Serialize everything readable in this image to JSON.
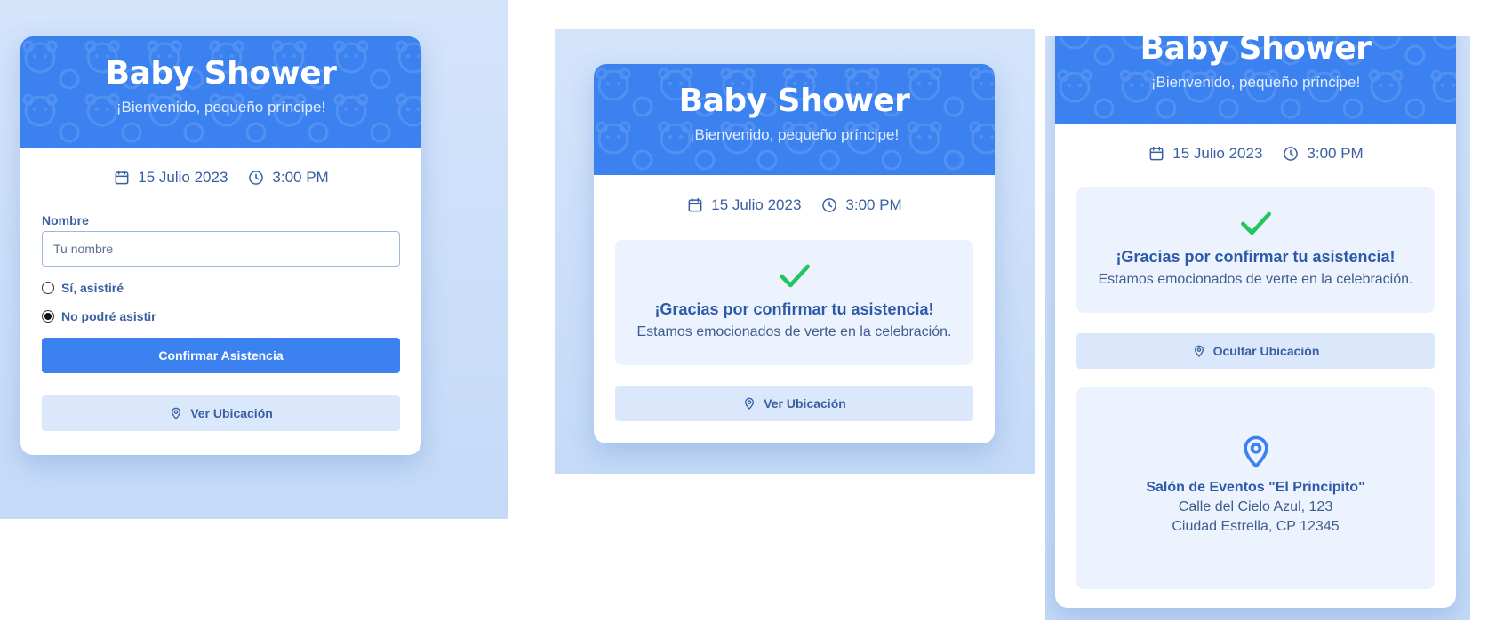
{
  "event": {
    "title": "Baby Shower",
    "subtitle": "¡Bienvenido, pequeño príncipe!",
    "date": "15 Julio 2023",
    "time": "3:00 PM"
  },
  "form": {
    "name_label": "Nombre",
    "name_placeholder": "Tu nombre",
    "name_value": "",
    "options": [
      {
        "label": "Sí, asistiré",
        "selected": false
      },
      {
        "label": "No podré asistir",
        "selected": true
      }
    ],
    "submit_label": "Confirmar Asistencia"
  },
  "confirmation": {
    "title": "¡Gracias por confirmar tu asistencia!",
    "message": "Estamos emocionados de verte en la celebración."
  },
  "location": {
    "show_label": "Ver Ubicación",
    "hide_label": "Ocultar Ubicación",
    "venue": "Salón de Eventos \"El Principito\"",
    "address_line1": "Calle del Cielo Azul, 123",
    "address_line2": "Ciudad Estrella, CP 12345"
  },
  "icons": {
    "date": "calendar-icon",
    "time": "clock-icon",
    "location": "map-pin-icon",
    "success": "check-icon"
  },
  "colors": {
    "primary": "#3b82f0",
    "background": "#d4e4fb",
    "success": "#22c55e",
    "text": "#3a5fa0"
  }
}
